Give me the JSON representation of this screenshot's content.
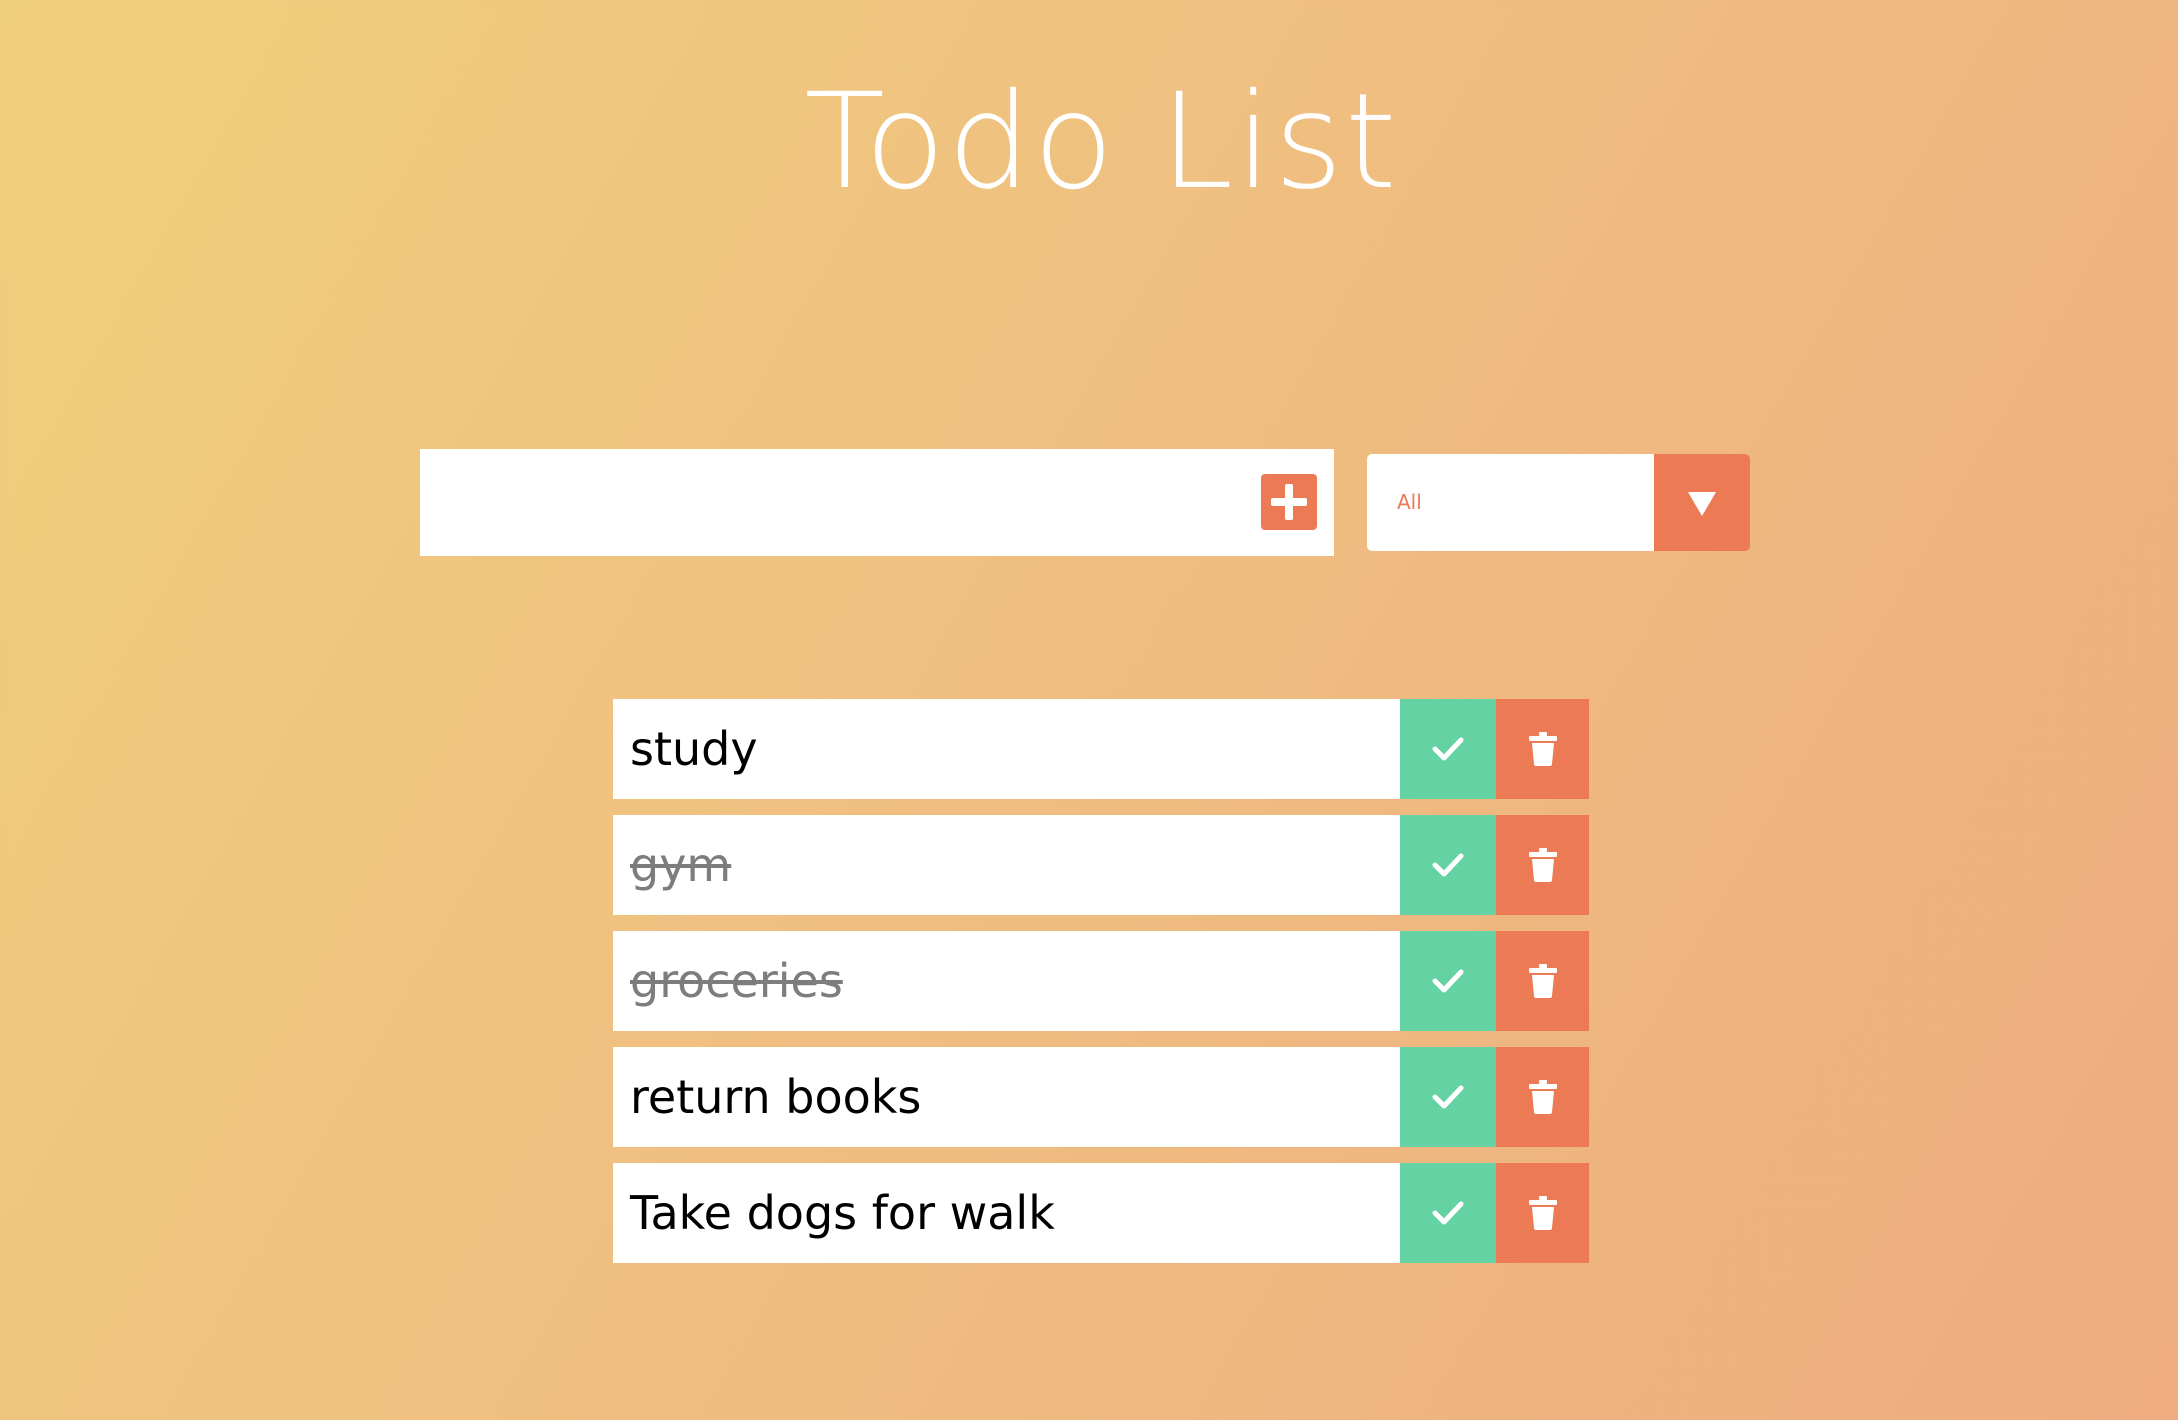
{
  "header": {
    "title": "Todo List"
  },
  "form": {
    "input_value": "",
    "add_icon": "plus-square-icon",
    "filter_selected": "All",
    "filter_icon": "caret-down-icon"
  },
  "todos": [
    {
      "text": "study",
      "completed": false
    },
    {
      "text": "gym",
      "completed": true
    },
    {
      "text": "groceries",
      "completed": true
    },
    {
      "text": "return books",
      "completed": false
    },
    {
      "text": "Take dogs for walk",
      "completed": false
    }
  ],
  "colors": {
    "accent": "#eb7a55",
    "complete": "#64d2a3",
    "background_start": "#f0cf7b",
    "background_end": "#eeac80"
  }
}
